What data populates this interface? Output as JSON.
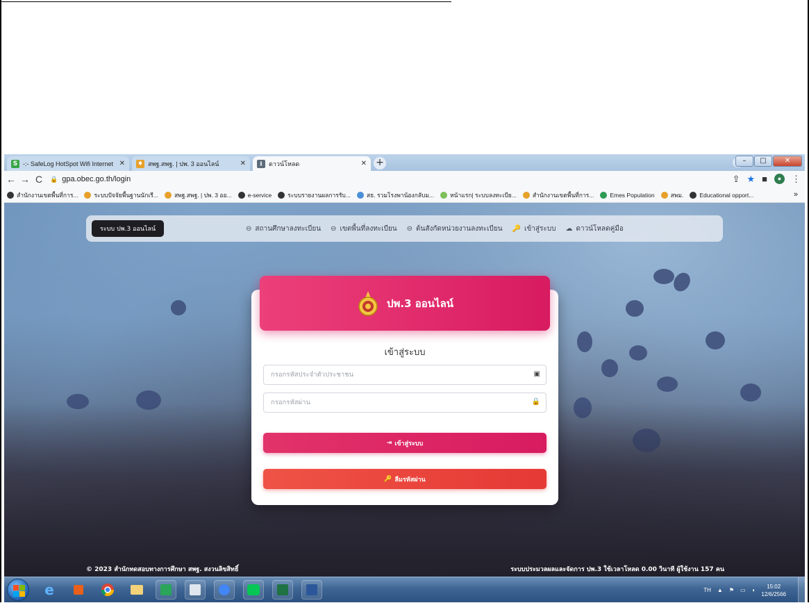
{
  "browser": {
    "tabs": [
      {
        "label": "-:- SafeLog HotSpot Wifi Internet",
        "icon": "safelog-icon"
      },
      {
        "label": "สพฐ.สพฐ. | ปพ. 3 ออนไลน์",
        "icon": "obec-icon"
      },
      {
        "label": "ดาวน์โหลด",
        "icon": "download-icon"
      }
    ],
    "url": "gpa.obec.go.th/login",
    "bookmarks": [
      "สำนักงานเขตพื้นที่การ...",
      "ระบบปัจจัยพื้นฐานนักเรี...",
      "สพฐ.สพฐ. | ปพ. 3 ออ...",
      "e-service",
      "ระบบรายงานผลการรับ...",
      "สธ. รวมโรงพาน้องกลับม...",
      "หน้าแรก| ระบบลงทะเบีย...",
      "สำนักงานเขตพื้นที่การ...",
      "Emes Population",
      "สพม.",
      "Educational opport..."
    ]
  },
  "nav": {
    "brand": "ระบบ ปพ.3 ออนไลน์",
    "links": [
      "สถานศึกษาลงทะเบียน",
      "เขตพื้นที่ลงทะเบียน",
      "ต้นสังกัดหน่วยงานลงทะเบียน",
      "เข้าสู่ระบบ",
      "ดาวน์โหลดคู่มือ"
    ]
  },
  "card": {
    "header": "ปพ.3 ออนไลน์",
    "title": "เข้าสู่ระบบ",
    "id_placeholder": "กรอกรหัสประจำตัวประชาชน",
    "password_placeholder": "กรอกรหัสผ่าน",
    "login_button": "เข้าสู่ระบบ",
    "reset_button": "ลืมรหัสผ่าน"
  },
  "footer": {
    "left": "© 2023 สำนักทดสอบทางการศึกษา สพฐ. สงวนลิขสิทธิ์",
    "right": "ระบบประมวลผลและจัดการ ปพ.3 ใช้เวลาโหลด 0.00 วินาที ผู้ใช้งาน 157 คน"
  },
  "taskbar": {
    "lang": "TH",
    "time": "15:02",
    "date": "12/6/2566"
  },
  "colors": {
    "primary": "#d81b60",
    "danger": "#e53935"
  }
}
